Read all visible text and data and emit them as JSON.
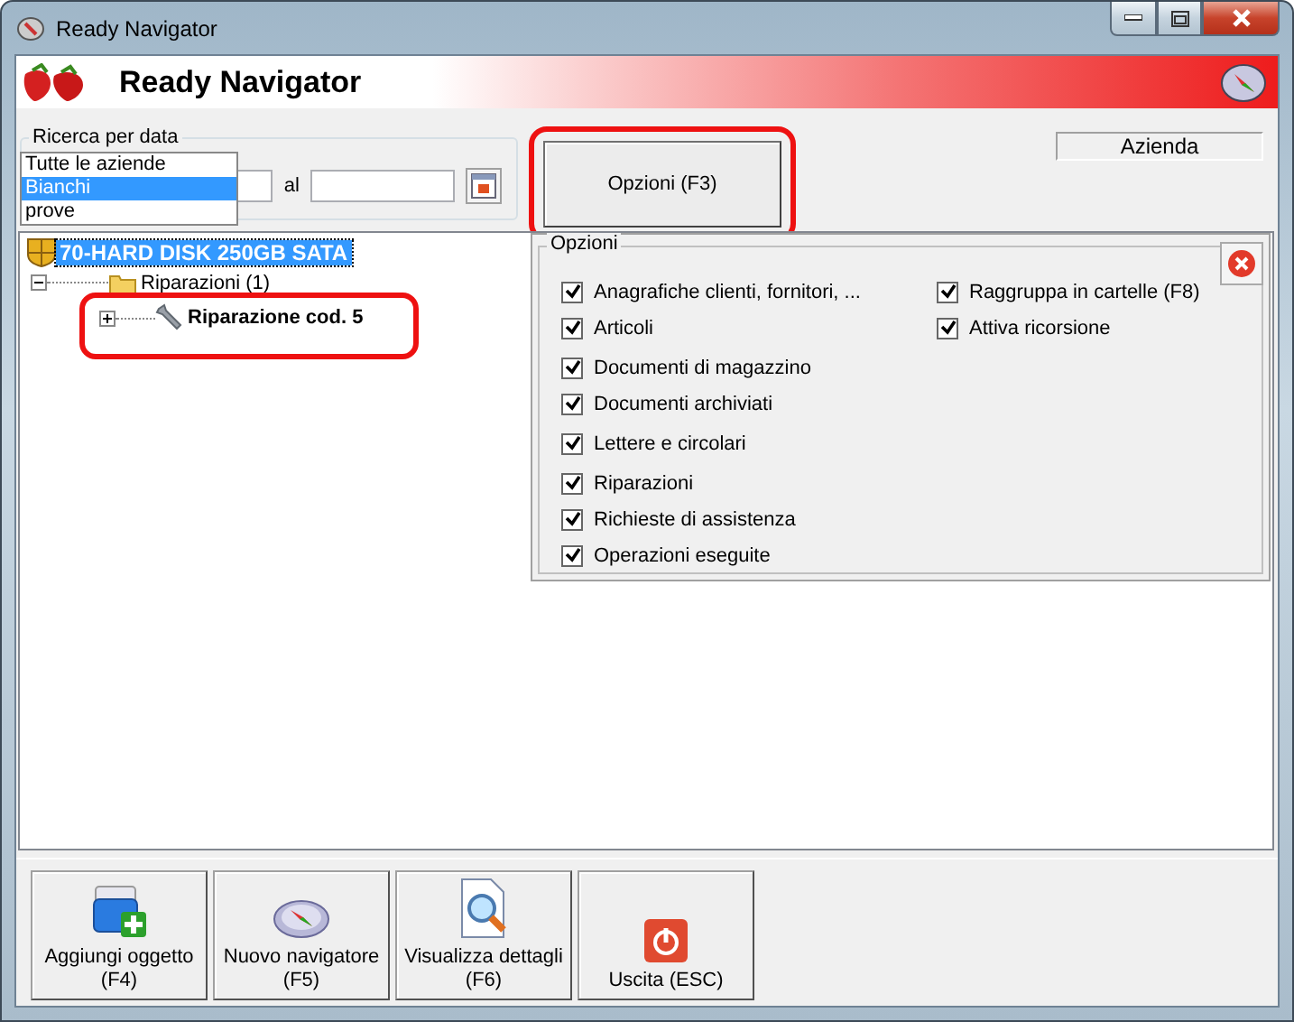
{
  "window": {
    "title": "Ready Navigator"
  },
  "header": {
    "title": "Ready Navigator"
  },
  "date_search": {
    "label": "Ricerca per data",
    "between": "al"
  },
  "company_dropdown": {
    "items": [
      {
        "label": "Tutte le aziende",
        "selected": false
      },
      {
        "label": "Bianchi",
        "selected": true
      },
      {
        "label": "prove",
        "selected": false
      }
    ]
  },
  "options_button": {
    "label": "Opzioni (F3)",
    "highlighted": true
  },
  "company_label": "Azienda",
  "tree": [
    {
      "label": "70-HARD DISK 250GB SATA",
      "selected": true,
      "children": [
        {
          "label": "Riparazioni (1)",
          "selected": false,
          "expanded": true,
          "children": [
            {
              "label": "Riparazione cod. 5",
              "selected": false,
              "highlighted": true,
              "expanded": false
            }
          ]
        }
      ]
    }
  ],
  "options_panel": {
    "title": "Opzioni",
    "left_items": [
      {
        "label": "Anagrafiche clienti, fornitori, ...",
        "checked": true
      },
      {
        "label": "Articoli",
        "checked": true
      },
      {
        "label": "Documenti di magazzino",
        "checked": true
      },
      {
        "label": "Documenti archiviati",
        "checked": true
      },
      {
        "label": "Lettere e circolari",
        "checked": true
      },
      {
        "label": "Riparazioni",
        "checked": true
      },
      {
        "label": "Richieste di assistenza",
        "checked": true
      },
      {
        "label": "Operazioni eseguite",
        "checked": true
      }
    ],
    "right_items": [
      {
        "label": "Raggruppa in cartelle (F8)",
        "checked": true
      },
      {
        "label": "Attiva ricorsione",
        "checked": true
      }
    ]
  },
  "toolbar": [
    {
      "kind": "add",
      "lines": [
        "Aggiungi oggetto",
        "(F4)"
      ]
    },
    {
      "kind": "compass",
      "lines": [
        "Nuovo navigatore",
        "(F5)"
      ]
    },
    {
      "kind": "magnifier",
      "lines": [
        "Visualizza dettagli",
        "(F6)"
      ]
    },
    {
      "kind": "power",
      "lines": [
        "Uscita (ESC)"
      ]
    }
  ]
}
